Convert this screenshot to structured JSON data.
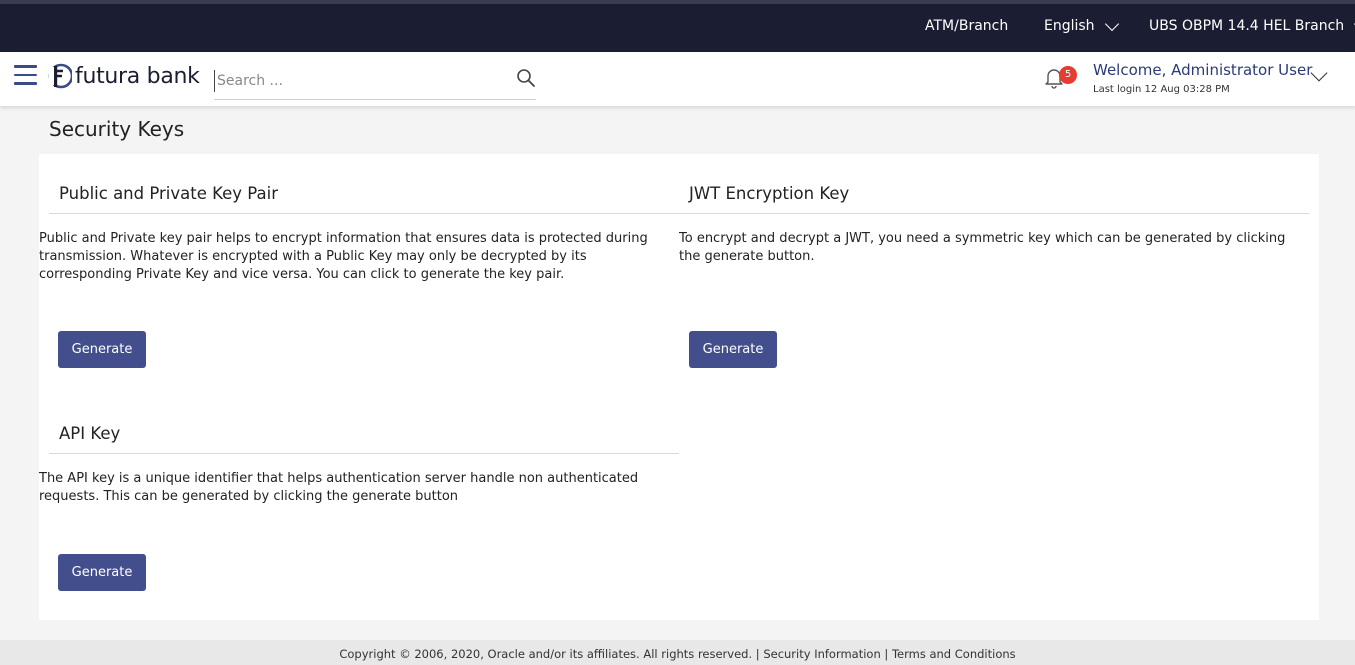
{
  "topbar": {
    "atm_branch": "ATM/Branch",
    "language": "English",
    "branch": "UBS OBPM 14.4 HEL Branch"
  },
  "header": {
    "logo_text": "futura bank",
    "search_placeholder": "Search ...",
    "notification_count": "5",
    "welcome": "Welcome, Administrator User",
    "last_login": "Last login 12 Aug 03:28 PM"
  },
  "page": {
    "title": "Security Keys"
  },
  "sections": {
    "key_pair": {
      "title": "Public and Private Key Pair",
      "description": "Public and Private key pair helps to encrypt information that ensures data is protected during transmission. Whatever is encrypted with a Public Key may only be decrypted by its corresponding Private Key and vice versa. You can click to generate the key pair.",
      "button": "Generate"
    },
    "jwt": {
      "title": "JWT Encryption Key",
      "description": "To encrypt and decrypt a JWT, you need a symmetric key which can be generated by clicking the generate button.",
      "button": "Generate"
    },
    "api": {
      "title": "API Key",
      "description": "The API key is a unique identifier that helps authentication server handle non authenticated requests. This can be generated by clicking the generate button",
      "button": "Generate"
    }
  },
  "footer": {
    "copyright": "Copyright © 2006, 2020, Oracle and/or its affiliates. All rights reserved.",
    "separator": "|",
    "security_info": "Security Information",
    "terms": "Terms and Conditions"
  },
  "colors": {
    "topbar_bg": "#1b1e33",
    "accent": "#434f8c",
    "badge": "#e53d2f"
  }
}
